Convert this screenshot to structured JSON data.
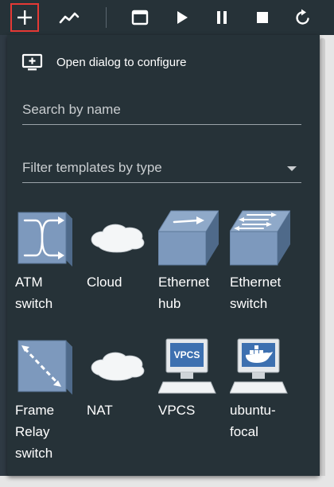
{
  "toolbar": {
    "buttons": [
      {
        "name": "add-icon",
        "label": "+"
      },
      {
        "name": "chart-icon"
      },
      {
        "name": "console-icon"
      },
      {
        "name": "play-icon"
      },
      {
        "name": "pause-icon"
      },
      {
        "name": "stop-icon"
      },
      {
        "name": "reload-icon"
      }
    ],
    "accent": "#e53935"
  },
  "panel": {
    "open_dialog_label": "Open dialog to configure",
    "search_placeholder": "Search by name",
    "filter_placeholder": "Filter templates by type",
    "templates": [
      {
        "icon": "atm-switch-icon",
        "name": "ATM switch"
      },
      {
        "icon": "cloud-icon",
        "name": "Cloud"
      },
      {
        "icon": "ethernet-hub-icon",
        "name": "Ethernet hub"
      },
      {
        "icon": "ethernet-switch-icon",
        "name": "Ethernet switch"
      },
      {
        "icon": "frame-relay-switch-icon",
        "name": "Frame Relay switch"
      },
      {
        "icon": "nat-icon",
        "name": "NAT"
      },
      {
        "icon": "vpcs-icon",
        "name": "VPCS",
        "screen_text": "VPCS"
      },
      {
        "icon": "ubuntu-focal-icon",
        "name": "ubuntu-focal"
      }
    ]
  }
}
